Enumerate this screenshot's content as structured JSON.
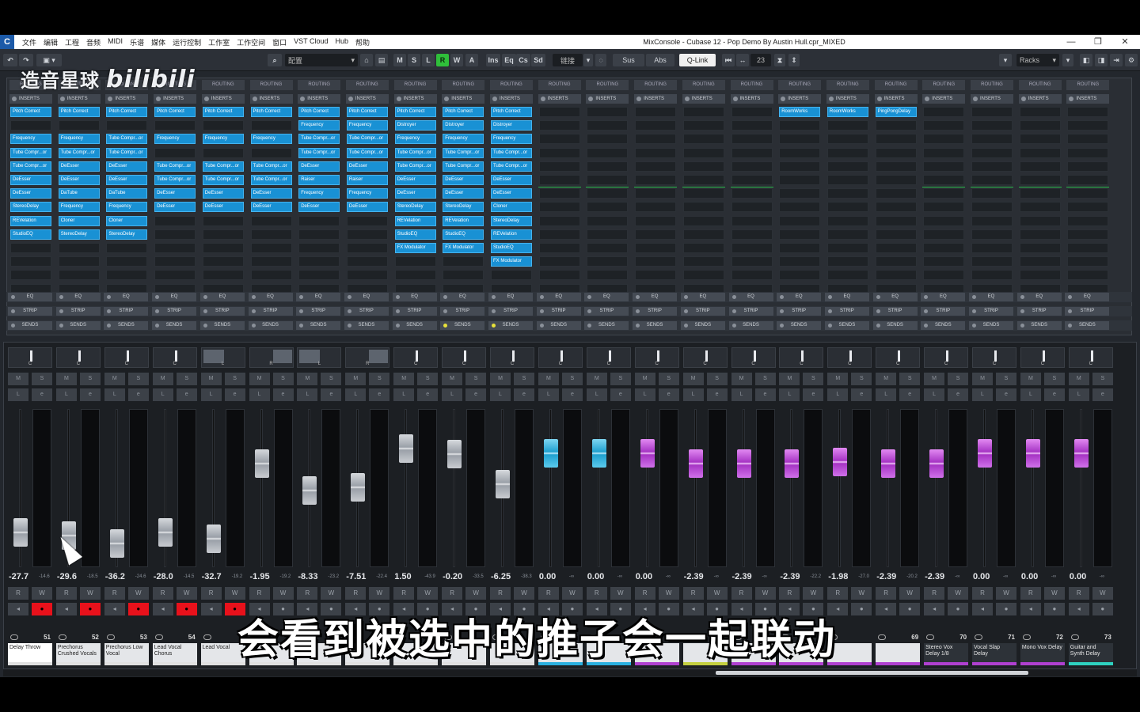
{
  "window": {
    "title": "MixConsole - Cubase 12 - Pop Demo By Austin Hull.cpr_MIXED",
    "menu": [
      "文件",
      "编辑",
      "工程",
      "音频",
      "MIDI",
      "乐谱",
      "媒体",
      "运行控制",
      "工作室",
      "工作空间",
      "窗口",
      "VST Cloud",
      "Hub",
      "帮助"
    ]
  },
  "toolbar": {
    "config_label": "配置",
    "mode_buttons": [
      "M",
      "S",
      "L",
      "R",
      "W",
      "A"
    ],
    "view_buttons": [
      "Ins",
      "Eq",
      "Cs",
      "Sd"
    ],
    "link_label": "链接",
    "sus": "Sus",
    "abs": "Abs",
    "qlink": "Q-Link",
    "channel_count": "23",
    "racks": "Racks"
  },
  "rack": {
    "routing_label": "ROUTING",
    "inserts_label": "INSERTS",
    "eq_label": "EQ",
    "strip_label": "STRIP",
    "sends_label": "SENDS",
    "inserts": [
      [
        "Pitch Correct",
        "",
        "Frequency",
        "Tube Compr...or",
        "Tube Compr...or",
        "DeEsser",
        "DeEsser",
        "StereoDelay",
        "REVelation",
        "StudioEQ"
      ],
      [
        "Pitch Correct",
        "",
        "Frequency",
        "Tube Compr...or",
        "DeEsser",
        "DeEsser",
        "DaTube",
        "Frequency",
        "Cloner",
        "StereoDelay"
      ],
      [
        "Pitch Correct",
        "",
        "Tube Compr...or",
        "Tube Compr...or",
        "DeEsser",
        "DeEsser",
        "DaTube",
        "Frequency",
        "Cloner",
        "StereoDelay"
      ],
      [
        "Pitch Correct",
        "",
        "Frequency",
        "",
        "Tube Compr...or",
        "Tube Compr...or",
        "DeEsser",
        "DeEsser"
      ],
      [
        "Pitch Correct",
        "",
        "Frequency",
        "",
        "Tube Compr...or",
        "Tube Compr...or",
        "DeEsser",
        "DeEsser"
      ],
      [
        "Pitch Correct",
        "",
        "Frequency",
        "",
        "Tube Compr...or",
        "Tube Compr...or",
        "DeEsser",
        "DeEsser"
      ],
      [
        "Pitch Correct",
        "Frequency",
        "Tube Compr...or",
        "Tube Compr...or",
        "DeEsser",
        "Raiser",
        "Frequency",
        "DeEsser"
      ],
      [
        "Pitch Correct",
        "Frequency",
        "Tube Compr...or",
        "Tube Compr...or",
        "DeEsser",
        "Raiser",
        "Frequency",
        "DeEsser"
      ],
      [
        "Pitch Correct",
        "Distroyer",
        "Frequency",
        "Tube Compr...or",
        "Tube Compr...or",
        "DeEsser",
        "DeEsser",
        "StereoDelay",
        "REVelation",
        "StudioEQ",
        "FX Modulator"
      ],
      [
        "Pitch Correct",
        "Distroyer",
        "Frequency",
        "Tube Compr...or",
        "Tube Compr...or",
        "DeEsser",
        "DeEsser",
        "StereoDelay",
        "REVelation",
        "StudioEQ",
        "FX Modulator"
      ],
      [
        "Pitch Correct",
        "Distroyer",
        "Frequency",
        "Tube Compr...or",
        "Tube Compr...or",
        "DeEsser",
        "DeEsser",
        "Cloner",
        "StereoDelay",
        "REVelation",
        "StudioEQ",
        "FX Modulator"
      ],
      [],
      [],
      [],
      [],
      [],
      [
        "RoomWorks"
      ],
      [
        "RoomWorks"
      ],
      [
        "PingPongDelay"
      ],
      [],
      [],
      [],
      []
    ],
    "sends_active": [
      false,
      false,
      false,
      false,
      false,
      false,
      false,
      false,
      false,
      true,
      true,
      false,
      false,
      false,
      false,
      false,
      false,
      false,
      false,
      false,
      false,
      false,
      false
    ]
  },
  "channels": [
    {
      "pan": "C",
      "volume": "-27.7",
      "peak": "-14.6",
      "level": 0.22,
      "color": "grey",
      "rec": true,
      "num": "51",
      "name": "Delay Throw",
      "bar": "#e0e0e0"
    },
    {
      "pan": "C",
      "volume": "-29.6",
      "peak": "-18.5",
      "level": 0.2,
      "color": "grey",
      "rec": true,
      "num": "52",
      "name": "Prechorus Crushed Vocals",
      "bar": "#e0e0e0"
    },
    {
      "pan": "C",
      "volume": "-36.2",
      "peak": "-24.6",
      "level": 0.15,
      "color": "grey",
      "rec": true,
      "num": "53",
      "name": "Prechorus Low Vocal",
      "bar": "#e0e0e0"
    },
    {
      "pan": "C",
      "volume": "-28.0",
      "peak": "-14.5",
      "level": 0.22,
      "color": "grey",
      "rec": true,
      "num": "54",
      "name": "Lead Vocal Chorus",
      "bar": "#e0e0e0"
    },
    {
      "pan": "L",
      "volume": "-32.7",
      "peak": "-19.2",
      "level": 0.18,
      "color": "grey",
      "rec": true,
      "num": "",
      "name": "Lead Vocal",
      "bar": "#e0e0e0"
    },
    {
      "pan": "R",
      "volume": "-1.95",
      "peak": "-19.2",
      "level": 0.68,
      "color": "grey",
      "rec": false,
      "num": "",
      "name": "",
      "bar": "#e0e0e0"
    },
    {
      "pan": "L",
      "volume": "-8.33",
      "peak": "-23.2",
      "level": 0.5,
      "color": "grey",
      "rec": false,
      "num": "",
      "name": "",
      "bar": "#e0e0e0"
    },
    {
      "pan": "R",
      "volume": "-7.51",
      "peak": "-22.4",
      "level": 0.52,
      "color": "grey",
      "rec": false,
      "num": "",
      "name": "",
      "bar": "#e0e0e0"
    },
    {
      "pan": "C",
      "volume": "1.50",
      "peak": "-43.9",
      "level": 0.78,
      "color": "grey",
      "rec": false,
      "num": "",
      "name": "",
      "bar": "#e0e0e0"
    },
    {
      "pan": "C",
      "volume": "-0.20",
      "peak": "-33.5",
      "level": 0.74,
      "color": "grey",
      "rec": false,
      "num": "",
      "name": "",
      "bar": "#e0e0e0"
    },
    {
      "pan": "C",
      "volume": "-6.25",
      "peak": "-38.3",
      "level": 0.54,
      "color": "grey",
      "rec": false,
      "num": "",
      "name": "",
      "bar": "#e0e0e0"
    },
    {
      "pan": "C",
      "volume": "0.00",
      "peak": "-∞",
      "level": 0.75,
      "color": "cyan",
      "rec": false,
      "num": "",
      "name": "",
      "bar": "#2ab0e0"
    },
    {
      "pan": "C",
      "volume": "0.00",
      "peak": "-∞",
      "level": 0.75,
      "color": "cyan",
      "rec": false,
      "num": "",
      "name": "",
      "bar": "#2ab0e0"
    },
    {
      "pan": "C",
      "volume": "0.00",
      "peak": "-∞",
      "level": 0.75,
      "color": "purple",
      "rec": false,
      "num": "",
      "name": "",
      "bar": "#b040d0"
    },
    {
      "pan": "C",
      "volume": "-2.39",
      "peak": "-∞",
      "level": 0.68,
      "color": "purple",
      "rec": false,
      "num": "",
      "name": "",
      "bar": "#c4d040"
    },
    {
      "pan": "C",
      "volume": "-2.39",
      "peak": "-∞",
      "level": 0.68,
      "color": "purple",
      "rec": false,
      "num": "",
      "name": "",
      "bar": "#b040d0"
    },
    {
      "pan": "C",
      "volume": "-2.39",
      "peak": "-22.2",
      "level": 0.68,
      "color": "purple",
      "rec": false,
      "num": "",
      "name": "",
      "bar": "#b040d0"
    },
    {
      "pan": "C",
      "volume": "-1.98",
      "peak": "-27.0",
      "level": 0.69,
      "color": "purple",
      "rec": false,
      "num": "",
      "name": "",
      "bar": "#b040d0"
    },
    {
      "pan": "C",
      "volume": "-2.39",
      "peak": "-20.2",
      "level": 0.68,
      "color": "purple",
      "rec": false,
      "num": "69",
      "name": "",
      "bar": "#b040d0"
    },
    {
      "pan": "C",
      "volume": "-2.39",
      "peak": "-∞",
      "level": 0.68,
      "color": "purple",
      "rec": false,
      "num": "70",
      "name": "Stereo Vox Delay 1/8",
      "bar": "#b040d0"
    },
    {
      "pan": "C",
      "volume": "0.00",
      "peak": "-∞",
      "level": 0.75,
      "color": "purple",
      "rec": false,
      "num": "71",
      "name": "Vocal Slap Delay",
      "bar": "#b040d0"
    },
    {
      "pan": "C",
      "volume": "0.00",
      "peak": "-∞",
      "level": 0.75,
      "color": "purple",
      "rec": false,
      "num": "72",
      "name": "Mono Vox Delay",
      "bar": "#b040d0"
    },
    {
      "pan": "C",
      "volume": "0.00",
      "peak": "-∞",
      "level": 0.75,
      "color": "purple",
      "rec": false,
      "num": "73",
      "name": "Guitar and Synth Delay",
      "bar": "#2ed1c0"
    }
  ],
  "overlay": {
    "watermark_channel": "造音星球",
    "watermark_site": "bilibili",
    "subtitle": "会看到被选中的推子会一起联动"
  }
}
